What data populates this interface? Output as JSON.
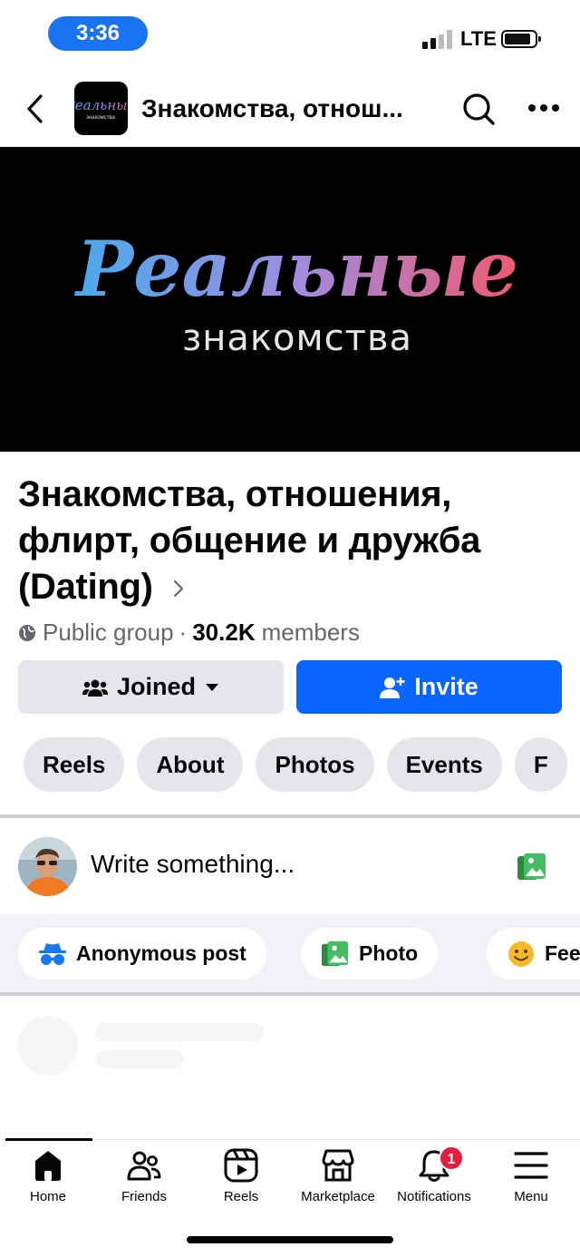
{
  "status_bar": {
    "time": "3:36",
    "network": "LTE"
  },
  "header": {
    "title": "Знакомства, отнош..."
  },
  "cover": {
    "title": "Реальные",
    "subtitle": "знакомства"
  },
  "avatar_logo": {
    "title": "Реальные",
    "subtitle": "знакомства"
  },
  "group": {
    "name": "Знакомства, отношения, флирт, общение и дружба (Dating)",
    "privacy": "Public group",
    "separator": "·",
    "members_count": "30.2K",
    "members_label": "members"
  },
  "actions": {
    "joined_label": "Joined",
    "invite_label": "Invite"
  },
  "tabs": [
    "Reels",
    "About",
    "Photos",
    "Events",
    "F"
  ],
  "composer": {
    "placeholder": "Write something...",
    "chips": [
      "Anonymous post",
      "Photo",
      "Fee"
    ]
  },
  "bottom_nav": {
    "items": [
      "Home",
      "Friends",
      "Reels",
      "Marketplace",
      "Notifications",
      "Menu"
    ],
    "notifications_badge": "1",
    "active": "Home"
  },
  "colors": {
    "accent": "#0866ff",
    "badge": "#e41e3f",
    "time_pill": "#1a73f0"
  }
}
